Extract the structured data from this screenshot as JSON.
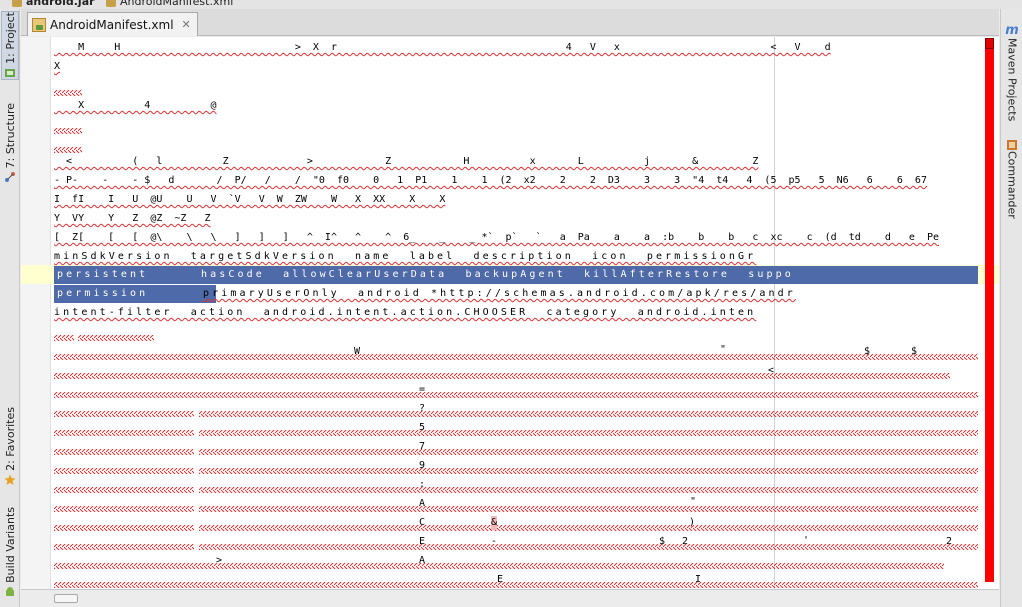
{
  "breadcrumbs": [
    "android.jar",
    "AndroidManifest.xml"
  ],
  "left_tools": {
    "project": "1: Project",
    "structure": "7: Structure",
    "favorites": "2: Favorites",
    "build_variants": "Build Variants"
  },
  "right_tools": {
    "maven": "Maven Projects",
    "commander": "Commander"
  },
  "tab": {
    "label": "AndroidManifest.xml",
    "close": "✕"
  },
  "editor_lines": {
    "l1": "    M     H                             >  X  r                                      4   V   x                         <   V    d",
    "l2": "X",
    "l4": "    X          4          @",
    "l6": "  <          (   l          Z             >            Z            H          x       L          j       &         Z",
    "l7": "- P-    -    - $   d       /  P/   /    /  \"0  f0    0   1  P1    1    1  (2  x2    2    2  D3    3    3  \"4  t4   4  (5  p5   5  N6   6    6  67",
    "l8": "I  fI    I   U  @U    U   V  `V   V  W  ZW    W   X  XX    X    X",
    "l9": "Y  VY    Y   Z  @Z  ~Z   Z",
    "l10": "[  Z[    [   [  @\\    \\   \\   ]   ]   ]   ^  I^   ^    ^  6_    _    _ *`  p`   `   a  Pa    a    a  :b    b    b   c  xc    c  (d  td    d   e  Pe",
    "l11": "minSdkVersion  targetSdkVersion  name  label  description  icon  permissionGr",
    "l12_sel": "persistent",
    "l12_rest": "hasCode  allowClearUserData  backupAgent  killAfterRestore  suppo",
    "l13_sel": "permission",
    "l13_rest": "primaryUserOnly  android *http://schemas.android.com/apk/res/andr",
    "l14": "intent-filter  action  android.intent.action.CHOOSER  category  android.inten"
  },
  "scattered_glyphs": {
    "w": "W",
    "quote": "\"",
    "dollar1": "$",
    "dollar2": "$",
    "lt": "<",
    "eq": "=",
    "q": "?",
    "five": "5",
    "seven": "7",
    "nine": "9",
    "colon": ":",
    "A1": "A",
    "dq2": "\"",
    "C": "C",
    "amp": "&",
    "rparen": ")",
    "E": "E",
    "dash": "-",
    "dollar3": "$",
    "two1": "2",
    "apos": "'",
    "two2": "2",
    "gt": ">",
    "A2": "A",
    "E2": "E",
    "I": "I"
  },
  "colors": {
    "selection": "#4e6aa8",
    "error_underline": "#e03030",
    "error_stripe": "#ff0000",
    "current_line": "#ffffd0"
  }
}
